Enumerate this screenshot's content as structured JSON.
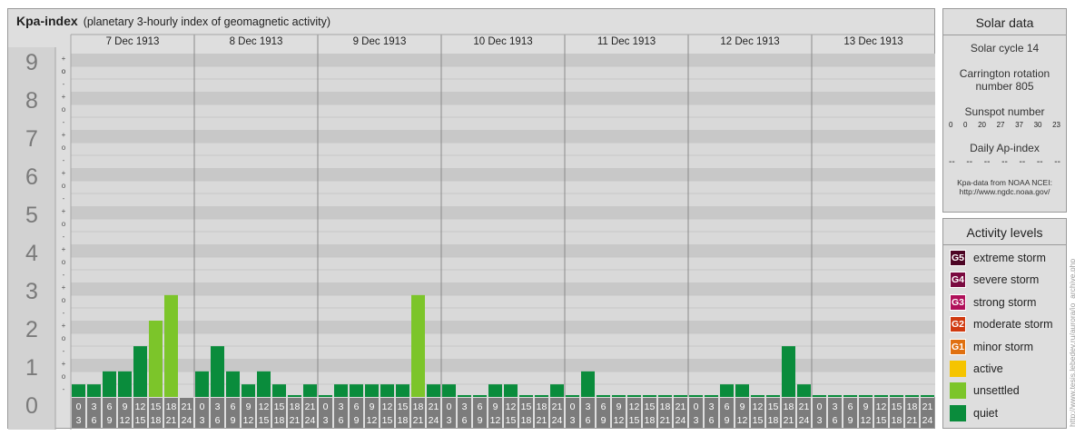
{
  "title": "Kpa-index",
  "subtitle": "(planetary 3-hourly index of geomagnetic activity)",
  "colors": {
    "quiet": "#0a8c3c",
    "unsettled": "#7cc52a",
    "active": "#f5c400",
    "G1": "#e07010",
    "G2": "#d03a10",
    "G3": "#b0105a",
    "G4": "#7a0a40",
    "G5": "#4d0524"
  },
  "chart_data": {
    "type": "bar",
    "title": "Kpa-index",
    "subtitle": "(planetary 3-hourly index of geomagnetic activity)",
    "ylim": [
      0,
      9
    ],
    "y_ticks": [
      "0",
      "1",
      "2",
      "3",
      "4",
      "5",
      "6",
      "7",
      "8",
      "9"
    ],
    "sub_ticks": [
      "+",
      "o",
      "-"
    ],
    "days": [
      "7 Dec 1913",
      "8 Dec 1913",
      "9 Dec 1913",
      "10 Dec 1913",
      "11 Dec 1913",
      "12 Dec 1913",
      "13 Dec 1913"
    ],
    "interval_start": [
      "0",
      "3",
      "6",
      "9",
      "12",
      "15",
      "18",
      "21"
    ],
    "interval_end": [
      "3",
      "6",
      "9",
      "12",
      "15",
      "18",
      "21",
      "24"
    ],
    "values": [
      [
        0.33,
        0.33,
        0.67,
        0.67,
        1.33,
        2.0,
        2.67
      ],
      [
        0.67,
        1.33,
        0.67,
        0.33,
        0.67,
        0.33,
        0,
        0.33
      ],
      [
        0,
        0.33,
        0.33,
        0.33,
        0.33,
        0.33,
        2.67,
        0.33
      ],
      [
        0.33,
        0,
        0,
        0.33,
        0.33,
        0,
        0,
        0.33
      ],
      [
        0,
        0.67,
        0,
        0,
        0,
        0,
        0,
        0
      ],
      [
        0,
        0,
        0.33,
        0.33,
        0,
        0,
        1.33,
        0.33
      ],
      [
        0,
        0,
        0,
        0,
        0,
        0,
        0,
        0
      ]
    ],
    "level_categories": [
      [
        "quiet",
        "quiet",
        "quiet",
        "quiet",
        "quiet",
        "unsettled",
        "unsettled"
      ],
      [
        "quiet",
        "quiet",
        "quiet",
        "quiet",
        "quiet",
        "quiet",
        "quiet",
        "quiet"
      ],
      [
        "quiet",
        "quiet",
        "quiet",
        "quiet",
        "quiet",
        "quiet",
        "unsettled",
        "quiet"
      ],
      [
        "quiet",
        "quiet",
        "quiet",
        "quiet",
        "quiet",
        "quiet",
        "quiet",
        "quiet"
      ],
      [
        "quiet",
        "quiet",
        "quiet",
        "quiet",
        "quiet",
        "quiet",
        "quiet",
        "quiet"
      ],
      [
        "quiet",
        "quiet",
        "quiet",
        "quiet",
        "quiet",
        "quiet",
        "quiet",
        "quiet"
      ],
      [
        "quiet",
        "quiet",
        "quiet",
        "quiet",
        "quiet",
        "quiet",
        "quiet",
        "quiet"
      ]
    ]
  },
  "solar": {
    "title": "Solar data",
    "cycle": "Solar cycle 14",
    "carrington_1": "Carrington rotation",
    "carrington_2": "number 805",
    "sunspot_title": "Sunspot number",
    "sunspots": [
      "0",
      "0",
      "20",
      "27",
      "37",
      "30",
      "23"
    ],
    "ap_title": "Daily Ap-index",
    "ap_values": [
      "--",
      "--",
      "--",
      "--",
      "--",
      "--",
      "--"
    ],
    "source_1": "Kpa-data from NOAA NCEI:",
    "source_2": "http://www.ngdc.noaa.gov/"
  },
  "activity": {
    "title": "Activity levels",
    "levels": [
      {
        "badge": "G5",
        "label": "extreme storm",
        "color": "#4d0524"
      },
      {
        "badge": "G4",
        "label": "severe storm",
        "color": "#7a0a40"
      },
      {
        "badge": "G3",
        "label": "strong storm",
        "color": "#b0105a"
      },
      {
        "badge": "G2",
        "label": "moderate storm",
        "color": "#d03a10"
      },
      {
        "badge": "G1",
        "label": "minor storm",
        "color": "#e07010"
      },
      {
        "badge": "",
        "label": "active",
        "color": "#f5c400"
      },
      {
        "badge": "",
        "label": "unsettled",
        "color": "#7cc52a"
      },
      {
        "badge": "",
        "label": "quiet",
        "color": "#0a8c3c"
      }
    ]
  },
  "credit": "http://www.tesis.lebedev.ru/aurora/io_archive.php"
}
